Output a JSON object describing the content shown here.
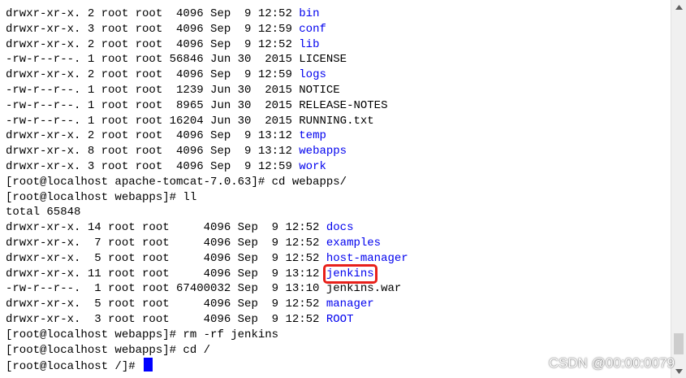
{
  "terminal": {
    "lines": [
      {
        "prefix": "drwxr-xr-x. 2 root root  4096 Sep  9 12:52 ",
        "name": "bin",
        "kind": "dir"
      },
      {
        "prefix": "drwxr-xr-x. 3 root root  4096 Sep  9 12:59 ",
        "name": "conf",
        "kind": "dir"
      },
      {
        "prefix": "drwxr-xr-x. 2 root root  4096 Sep  9 12:52 ",
        "name": "lib",
        "kind": "dir"
      },
      {
        "prefix": "-rw-r--r--. 1 root root 56846 Jun 30  2015 ",
        "name": "LICENSE",
        "kind": "file"
      },
      {
        "prefix": "drwxr-xr-x. 2 root root  4096 Sep  9 12:59 ",
        "name": "logs",
        "kind": "dir"
      },
      {
        "prefix": "-rw-r--r--. 1 root root  1239 Jun 30  2015 ",
        "name": "NOTICE",
        "kind": "file"
      },
      {
        "prefix": "-rw-r--r--. 1 root root  8965 Jun 30  2015 ",
        "name": "RELEASE-NOTES",
        "kind": "file"
      },
      {
        "prefix": "-rw-r--r--. 1 root root 16204 Jun 30  2015 ",
        "name": "RUNNING.txt",
        "kind": "file"
      },
      {
        "prefix": "drwxr-xr-x. 2 root root  4096 Sep  9 13:12 ",
        "name": "temp",
        "kind": "dir"
      },
      {
        "prefix": "drwxr-xr-x. 8 root root  4096 Sep  9 13:12 ",
        "name": "webapps",
        "kind": "dir"
      },
      {
        "prefix": "drwxr-xr-x. 3 root root  4096 Sep  9 12:59 ",
        "name": "work",
        "kind": "dir"
      },
      {
        "prefix": "[root@localhost apache-tomcat-7.0.63]# cd webapps/",
        "name": "",
        "kind": "cmd"
      },
      {
        "prefix": "[root@localhost webapps]# ll",
        "name": "",
        "kind": "cmd"
      },
      {
        "prefix": "total 65848",
        "name": "",
        "kind": "text"
      },
      {
        "prefix": "drwxr-xr-x. 14 root root     4096 Sep  9 12:52 ",
        "name": "docs",
        "kind": "dir"
      },
      {
        "prefix": "drwxr-xr-x.  7 root root     4096 Sep  9 12:52 ",
        "name": "examples",
        "kind": "dir"
      },
      {
        "prefix": "drwxr-xr-x.  5 root root     4096 Sep  9 12:52 ",
        "name": "host-manager",
        "kind": "dir"
      },
      {
        "prefix": "drwxr-xr-x. 11 root root     4096 Sep  9 13:12 ",
        "name": "jenkins",
        "kind": "dir-highlight"
      },
      {
        "prefix": "-rw-r--r--.  1 root root 67400032 Sep  9 13:10 ",
        "name": "jenkins.war",
        "kind": "file"
      },
      {
        "prefix": "drwxr-xr-x.  5 root root     4096 Sep  9 12:52 ",
        "name": "manager",
        "kind": "dir"
      },
      {
        "prefix": "drwxr-xr-x.  3 root root     4096 Sep  9 12:52 ",
        "name": "ROOT",
        "kind": "dir"
      },
      {
        "prefix": "[root@localhost webapps]# rm -rf jenkins",
        "name": "",
        "kind": "cmd"
      },
      {
        "prefix": "[root@localhost webapps]# cd /",
        "name": "",
        "kind": "cmd"
      },
      {
        "prefix": "[root@localhost /]# ",
        "name": "",
        "kind": "prompt"
      }
    ]
  },
  "colors": {
    "directory": "#0000ee",
    "highlight_box": "#e8201a",
    "cursor": "#0000ff"
  },
  "scrollbar": {
    "up_icon": "triangle-up",
    "down_icon": "triangle-down",
    "position_fraction": 0.97
  },
  "watermark": {
    "text": "CSDN @00:00:0079"
  }
}
